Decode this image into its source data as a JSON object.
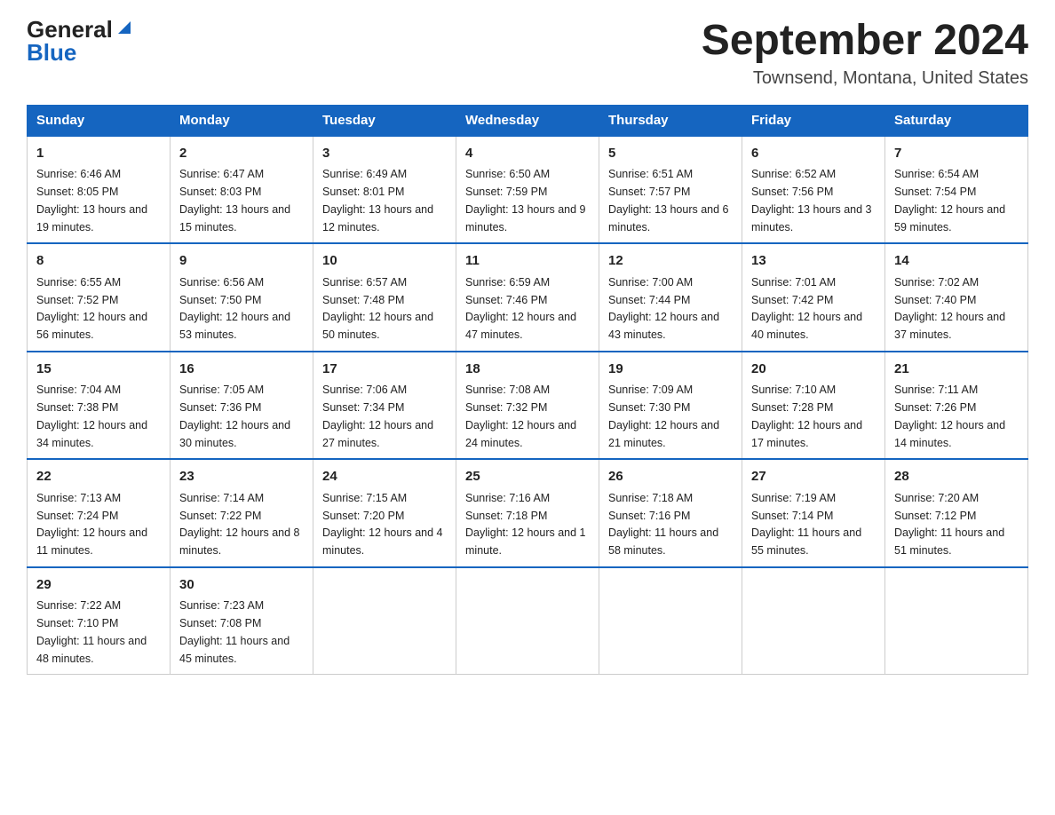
{
  "header": {
    "logo_general": "General",
    "logo_blue": "Blue",
    "title": "September 2024",
    "location": "Townsend, Montana, United States"
  },
  "weekdays": [
    "Sunday",
    "Monday",
    "Tuesday",
    "Wednesday",
    "Thursday",
    "Friday",
    "Saturday"
  ],
  "weeks": [
    [
      {
        "day": "1",
        "sunrise": "6:46 AM",
        "sunset": "8:05 PM",
        "daylight": "13 hours and 19 minutes."
      },
      {
        "day": "2",
        "sunrise": "6:47 AM",
        "sunset": "8:03 PM",
        "daylight": "13 hours and 15 minutes."
      },
      {
        "day": "3",
        "sunrise": "6:49 AM",
        "sunset": "8:01 PM",
        "daylight": "13 hours and 12 minutes."
      },
      {
        "day": "4",
        "sunrise": "6:50 AM",
        "sunset": "7:59 PM",
        "daylight": "13 hours and 9 minutes."
      },
      {
        "day": "5",
        "sunrise": "6:51 AM",
        "sunset": "7:57 PM",
        "daylight": "13 hours and 6 minutes."
      },
      {
        "day": "6",
        "sunrise": "6:52 AM",
        "sunset": "7:56 PM",
        "daylight": "13 hours and 3 minutes."
      },
      {
        "day": "7",
        "sunrise": "6:54 AM",
        "sunset": "7:54 PM",
        "daylight": "12 hours and 59 minutes."
      }
    ],
    [
      {
        "day": "8",
        "sunrise": "6:55 AM",
        "sunset": "7:52 PM",
        "daylight": "12 hours and 56 minutes."
      },
      {
        "day": "9",
        "sunrise": "6:56 AM",
        "sunset": "7:50 PM",
        "daylight": "12 hours and 53 minutes."
      },
      {
        "day": "10",
        "sunrise": "6:57 AM",
        "sunset": "7:48 PM",
        "daylight": "12 hours and 50 minutes."
      },
      {
        "day": "11",
        "sunrise": "6:59 AM",
        "sunset": "7:46 PM",
        "daylight": "12 hours and 47 minutes."
      },
      {
        "day": "12",
        "sunrise": "7:00 AM",
        "sunset": "7:44 PM",
        "daylight": "12 hours and 43 minutes."
      },
      {
        "day": "13",
        "sunrise": "7:01 AM",
        "sunset": "7:42 PM",
        "daylight": "12 hours and 40 minutes."
      },
      {
        "day": "14",
        "sunrise": "7:02 AM",
        "sunset": "7:40 PM",
        "daylight": "12 hours and 37 minutes."
      }
    ],
    [
      {
        "day": "15",
        "sunrise": "7:04 AM",
        "sunset": "7:38 PM",
        "daylight": "12 hours and 34 minutes."
      },
      {
        "day": "16",
        "sunrise": "7:05 AM",
        "sunset": "7:36 PM",
        "daylight": "12 hours and 30 minutes."
      },
      {
        "day": "17",
        "sunrise": "7:06 AM",
        "sunset": "7:34 PM",
        "daylight": "12 hours and 27 minutes."
      },
      {
        "day": "18",
        "sunrise": "7:08 AM",
        "sunset": "7:32 PM",
        "daylight": "12 hours and 24 minutes."
      },
      {
        "day": "19",
        "sunrise": "7:09 AM",
        "sunset": "7:30 PM",
        "daylight": "12 hours and 21 minutes."
      },
      {
        "day": "20",
        "sunrise": "7:10 AM",
        "sunset": "7:28 PM",
        "daylight": "12 hours and 17 minutes."
      },
      {
        "day": "21",
        "sunrise": "7:11 AM",
        "sunset": "7:26 PM",
        "daylight": "12 hours and 14 minutes."
      }
    ],
    [
      {
        "day": "22",
        "sunrise": "7:13 AM",
        "sunset": "7:24 PM",
        "daylight": "12 hours and 11 minutes."
      },
      {
        "day": "23",
        "sunrise": "7:14 AM",
        "sunset": "7:22 PM",
        "daylight": "12 hours and 8 minutes."
      },
      {
        "day": "24",
        "sunrise": "7:15 AM",
        "sunset": "7:20 PM",
        "daylight": "12 hours and 4 minutes."
      },
      {
        "day": "25",
        "sunrise": "7:16 AM",
        "sunset": "7:18 PM",
        "daylight": "12 hours and 1 minute."
      },
      {
        "day": "26",
        "sunrise": "7:18 AM",
        "sunset": "7:16 PM",
        "daylight": "11 hours and 58 minutes."
      },
      {
        "day": "27",
        "sunrise": "7:19 AM",
        "sunset": "7:14 PM",
        "daylight": "11 hours and 55 minutes."
      },
      {
        "day": "28",
        "sunrise": "7:20 AM",
        "sunset": "7:12 PM",
        "daylight": "11 hours and 51 minutes."
      }
    ],
    [
      {
        "day": "29",
        "sunrise": "7:22 AM",
        "sunset": "7:10 PM",
        "daylight": "11 hours and 48 minutes."
      },
      {
        "day": "30",
        "sunrise": "7:23 AM",
        "sunset": "7:08 PM",
        "daylight": "11 hours and 45 minutes."
      },
      null,
      null,
      null,
      null,
      null
    ]
  ]
}
